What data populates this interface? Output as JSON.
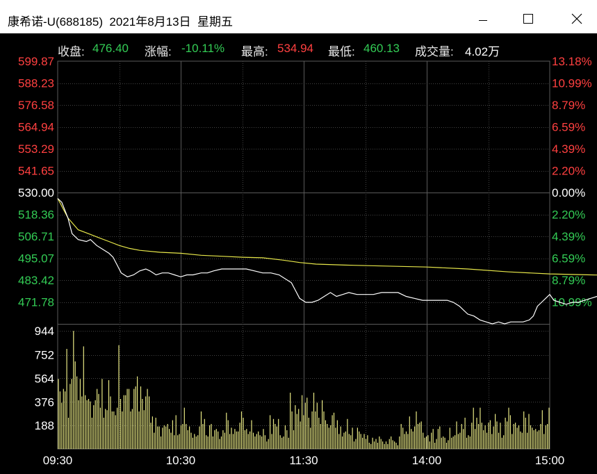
{
  "window": {
    "title": "康希诺-U(688185)  2021年8月13日  星期五",
    "minimize_icon": "minimize-icon",
    "maximize_icon": "maximize-icon",
    "close_icon": "close-icon"
  },
  "info": {
    "close_label": "收盘:",
    "close_value": "476.40",
    "change_label": "涨幅:",
    "change_value": "-10.11%",
    "high_label": "最高:",
    "high_value": "534.94",
    "low_label": "最低:",
    "low_value": "460.13",
    "volume_label": "成交量:",
    "volume_value": "4.02万"
  },
  "colors": {
    "up": "#ff4040",
    "down": "#33cc55",
    "neutral": "#ffffff",
    "price_line": "#ffffff",
    "avg_line": "#e8e84a",
    "volume_bar": "#e8e884",
    "grid_solid": "#5a5a5a",
    "grid_dotted": "#444444"
  },
  "chart_data": {
    "type": "line",
    "pre_close": 530.0,
    "ylim": [
      466.0,
      600.0
    ],
    "price_ticks_left": [
      "599.87",
      "588.23",
      "576.58",
      "564.94",
      "553.29",
      "541.65",
      "530.00",
      "518.36",
      "506.71",
      "495.07",
      "483.42",
      "471.78"
    ],
    "pct_ticks_right": [
      "13.18%",
      "10.99%",
      "8.79%",
      "6.59%",
      "4.39%",
      "2.20%",
      "0.00%",
      "2.20%",
      "4.39%",
      "6.59%",
      "8.79%",
      "10.99%"
    ],
    "volume_ticks": [
      "944",
      "752",
      "564",
      "376",
      "188"
    ],
    "volume_ylim": [
      0,
      1000
    ],
    "x_ticks": [
      "09:30",
      "10:30",
      "11:30",
      "14:00",
      "15:00"
    ],
    "price_series": [
      [
        0,
        530.0
      ],
      [
        2,
        528
      ],
      [
        5,
        520
      ],
      [
        7,
        512
      ],
      [
        10,
        509
      ],
      [
        14,
        508
      ],
      [
        16,
        509
      ],
      [
        19,
        506
      ],
      [
        22,
        504
      ],
      [
        25,
        502
      ],
      [
        27,
        500
      ],
      [
        29,
        496
      ],
      [
        31,
        492
      ],
      [
        34,
        490
      ],
      [
        37,
        491
      ],
      [
        40,
        493
      ],
      [
        43,
        494
      ],
      [
        45,
        493
      ],
      [
        48,
        491
      ],
      [
        51,
        492
      ],
      [
        54,
        492
      ],
      [
        57,
        491
      ],
      [
        60,
        490
      ],
      [
        63,
        491
      ],
      [
        66,
        491
      ],
      [
        70,
        492
      ],
      [
        73,
        492
      ],
      [
        76,
        493
      ],
      [
        80,
        494
      ],
      [
        84,
        494
      ],
      [
        88,
        494
      ],
      [
        92,
        494
      ],
      [
        96,
        493
      ],
      [
        100,
        492
      ],
      [
        104,
        492
      ],
      [
        108,
        491
      ],
      [
        111,
        489
      ],
      [
        114,
        487
      ],
      [
        116,
        483
      ],
      [
        118,
        479
      ],
      [
        121,
        477
      ],
      [
        124,
        477
      ],
      [
        127,
        478
      ],
      [
        130,
        480
      ],
      [
        133,
        482
      ],
      [
        136,
        480
      ],
      [
        139,
        481
      ],
      [
        142,
        482
      ],
      [
        146,
        481
      ],
      [
        150,
        481
      ],
      [
        154,
        481
      ],
      [
        158,
        482
      ],
      [
        162,
        482
      ],
      [
        166,
        482
      ],
      [
        170,
        480
      ],
      [
        174,
        479
      ],
      [
        178,
        478
      ],
      [
        182,
        478
      ],
      [
        186,
        478
      ],
      [
        190,
        478
      ],
      [
        193,
        477
      ],
      [
        196,
        475
      ],
      [
        198,
        473
      ],
      [
        200,
        471
      ],
      [
        203,
        470
      ],
      [
        206,
        468
      ],
      [
        209,
        467
      ],
      [
        212,
        466
      ],
      [
        215,
        467
      ],
      [
        218,
        466
      ],
      [
        221,
        467
      ],
      [
        224,
        467
      ],
      [
        227,
        467
      ],
      [
        230,
        468
      ],
      [
        232,
        470
      ],
      [
        234,
        475
      ],
      [
        236,
        477
      ],
      [
        238,
        479
      ],
      [
        240,
        481
      ],
      [
        242,
        478
      ],
      [
        245,
        477
      ],
      [
        248,
        476
      ],
      [
        251,
        477
      ],
      [
        254,
        477
      ],
      [
        257,
        478
      ],
      [
        260,
        479
      ],
      [
        263,
        480
      ],
      [
        266,
        480
      ],
      [
        270,
        480
      ],
      [
        272,
        479
      ]
    ],
    "avg_series": [
      [
        0,
        530.0
      ],
      [
        5,
        520
      ],
      [
        10,
        514
      ],
      [
        15,
        512
      ],
      [
        20,
        510
      ],
      [
        25,
        508
      ],
      [
        30,
        506
      ],
      [
        35,
        504.5
      ],
      [
        40,
        503.5
      ],
      [
        50,
        502.5
      ],
      [
        60,
        502
      ],
      [
        70,
        501
      ],
      [
        80,
        500.5
      ],
      [
        90,
        500
      ],
      [
        100,
        499.7
      ],
      [
        110,
        498.5
      ],
      [
        118,
        497.3
      ],
      [
        126,
        496.5
      ],
      [
        140,
        496
      ],
      [
        160,
        495.5
      ],
      [
        180,
        495
      ],
      [
        200,
        494
      ],
      [
        220,
        492.5
      ],
      [
        240,
        491.5
      ],
      [
        260,
        491
      ],
      [
        272,
        490.7
      ]
    ],
    "volumes": [
      560,
      460,
      370,
      480,
      460,
      800,
      250,
      520,
      560,
      944,
      700,
      580,
      390,
      560,
      420,
      820,
      430,
      390,
      400,
      380,
      250,
      350,
      390,
      480,
      440,
      330,
      560,
      250,
      320,
      310,
      550,
      420,
      300,
      300,
      270,
      330,
      830,
      400,
      300,
      430,
      430,
      480,
      480,
      300,
      320,
      480,
      500,
      580,
      300,
      500,
      400,
      310,
      420,
      480,
      420,
      210,
      260,
      130,
      250,
      180,
      180,
      100,
      170,
      190,
      180,
      200,
      160,
      130,
      230,
      110,
      270,
      110,
      120,
      190,
      200,
      330,
      200,
      150,
      180,
      130,
      90,
      120,
      100,
      110,
      180,
      300,
      200,
      240,
      110,
      100,
      190,
      200,
      100,
      150,
      160,
      140,
      80,
      100,
      150,
      130,
      290,
      230,
      120,
      170,
      120,
      160,
      140,
      140,
      210,
      300,
      250,
      150,
      160,
      120,
      140,
      230,
      130,
      100,
      120,
      140,
      110,
      100,
      160,
      110,
      60,
      80,
      270,
      120,
      240,
      200,
      180,
      240,
      110,
      90,
      100,
      190,
      150,
      90,
      450,
      300,
      150,
      350,
      280,
      320,
      220,
      430,
      270,
      370,
      410,
      250,
      170,
      300,
      450,
      300,
      370,
      250,
      200,
      390,
      300,
      230,
      200,
      170,
      190,
      270,
      290,
      170,
      230,
      120,
      180,
      100,
      130,
      140,
      240,
      120,
      110,
      170,
      60,
      80,
      170,
      140,
      120,
      90,
      120,
      80,
      110,
      50,
      40,
      90,
      60,
      80,
      50,
      100,
      80,
      60,
      40,
      60,
      40,
      80,
      100,
      70,
      60,
      50,
      30,
      100,
      200,
      170,
      120,
      140,
      120,
      260,
      160,
      140,
      180,
      300,
      200,
      210,
      220,
      130,
      90,
      100,
      110,
      60,
      130,
      160,
      50,
      80,
      160,
      180,
      90,
      100,
      90,
      50,
      70,
      170,
      90,
      100,
      110,
      220,
      120,
      130,
      200,
      160,
      250,
      90,
      110,
      100,
      210,
      330,
      160,
      250,
      200,
      330,
      210,
      150,
      190,
      130,
      210,
      230,
      120,
      180,
      280,
      220,
      130,
      210,
      90,
      110,
      250,
      220,
      330,
      270,
      120,
      200,
      210,
      170,
      190,
      140,
      130,
      300,
      250,
      130,
      280,
      190,
      170,
      150,
      160,
      140,
      150,
      200,
      310,
      120,
      190,
      200,
      330
    ]
  }
}
